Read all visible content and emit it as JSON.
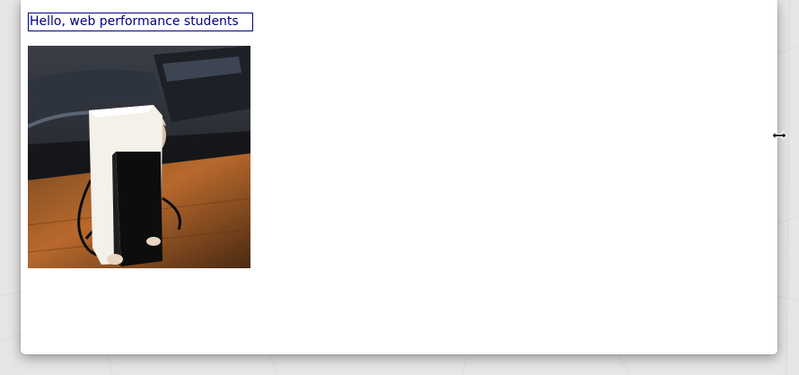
{
  "page": {
    "greeting_text": "Hello, web performance students"
  },
  "image": {
    "subject": "cat-in-paper-bag-photo"
  },
  "cursor": {
    "type": "horizontal-resize-cursor"
  },
  "colors": {
    "greeting_text": "#00007f",
    "greeting_border": "#00007f",
    "window_background": "#ffffff",
    "desktop_background": "#e6e6e6"
  }
}
